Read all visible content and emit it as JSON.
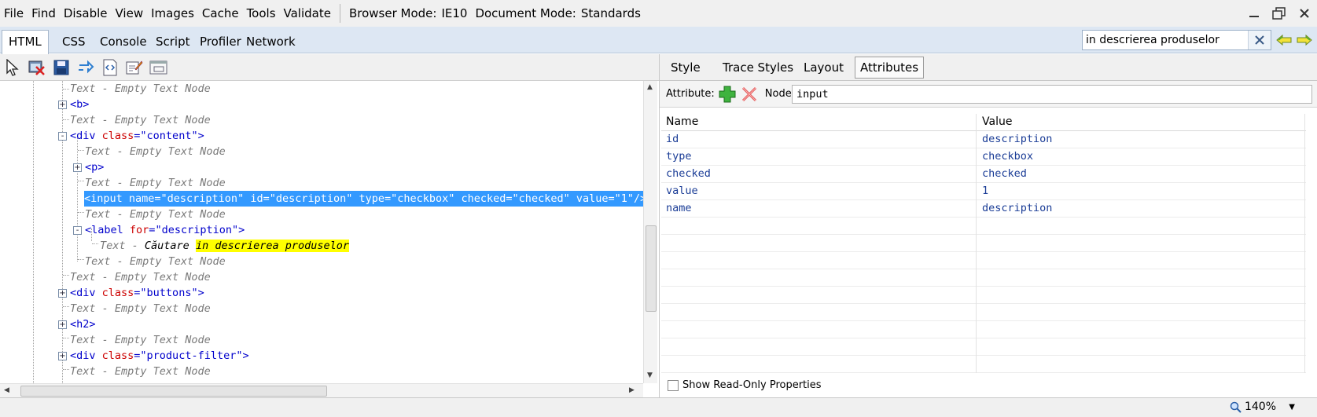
{
  "menu": {
    "items": [
      "File",
      "Find",
      "Disable",
      "View",
      "Images",
      "Cache",
      "Tools",
      "Validate"
    ],
    "browser_mode_label": "Browser Mode:",
    "browser_mode_value": "IE10",
    "document_mode_label": "Document Mode:",
    "document_mode_value": "Standards"
  },
  "tabs": [
    "HTML",
    "CSS",
    "Console",
    "Script",
    "Profiler",
    "Network"
  ],
  "active_tab": "HTML",
  "search": {
    "value": "in descrierea produselor"
  },
  "tree": [
    {
      "kind": "text",
      "text": "Text - Empty Text Node"
    },
    {
      "kind": "tag",
      "tag": "<b>",
      "expander": "+"
    },
    {
      "kind": "text",
      "text": "Text - Empty Text Node"
    },
    {
      "kind": "tag",
      "open": "<div ",
      "attr": "class",
      "eq": "=",
      "val": "\"content\"",
      "close": ">",
      "expander": "-"
    },
    {
      "kind": "text",
      "text": "Text - Empty Text Node"
    },
    {
      "kind": "tag",
      "tag": "<p>",
      "expander": "+"
    },
    {
      "kind": "text",
      "text": "Text - Empty Text Node"
    },
    {
      "kind": "selected",
      "text": "<input name=\"description\" id=\"description\" type=\"checkbox\" checked=\"checked\" value=\"1\"/>"
    },
    {
      "kind": "text",
      "text": "Text - Empty Text Node"
    },
    {
      "kind": "tag",
      "open": "<label ",
      "attr": "for",
      "eq": "=",
      "val": "\"description\"",
      "close": ">",
      "expander": "-"
    },
    {
      "kind": "textmatch",
      "prefix": "Text - ",
      "plain": "Căutare ",
      "match": "in descrierea produselor"
    },
    {
      "kind": "text",
      "text": "Text - Empty Text Node"
    },
    {
      "kind": "text",
      "text": "Text - Empty Text Node"
    },
    {
      "kind": "tag",
      "open": "<div ",
      "attr": "class",
      "eq": "=",
      "val": "\"buttons\"",
      "close": ">",
      "expander": "+"
    },
    {
      "kind": "text",
      "text": "Text - Empty Text Node"
    },
    {
      "kind": "tag",
      "tag": "<h2>",
      "expander": "+"
    },
    {
      "kind": "text",
      "text": "Text - Empty Text Node"
    },
    {
      "kind": "tag",
      "open": "<div ",
      "attr": "class",
      "eq": "=",
      "val": "\"product-filter\"",
      "close": ">",
      "expander": "+"
    },
    {
      "kind": "text",
      "text": "Text - Empty Text Node"
    }
  ],
  "right_tabs": [
    "Style",
    "Trace Styles",
    "Layout",
    "Attributes"
  ],
  "right_active_tab": "Attributes",
  "attr_bar": {
    "attribute_label": "Attribute:",
    "node_label": "Node:",
    "node_value": "input"
  },
  "grid": {
    "headers": {
      "name": "Name",
      "value": "Value"
    },
    "rows": [
      {
        "name": "id",
        "value": "description"
      },
      {
        "name": "type",
        "value": "checkbox"
      },
      {
        "name": "checked",
        "value": "checked"
      },
      {
        "name": "value",
        "value": "1"
      },
      {
        "name": "name",
        "value": "description"
      }
    ]
  },
  "readonly_label": "Show Read-Only Properties",
  "status": {
    "zoom": "140%"
  },
  "colors": {
    "selection": "#3399ff",
    "match_highlight": "#ffff00",
    "tag": "#0000cc",
    "attr": "#cc0000"
  }
}
